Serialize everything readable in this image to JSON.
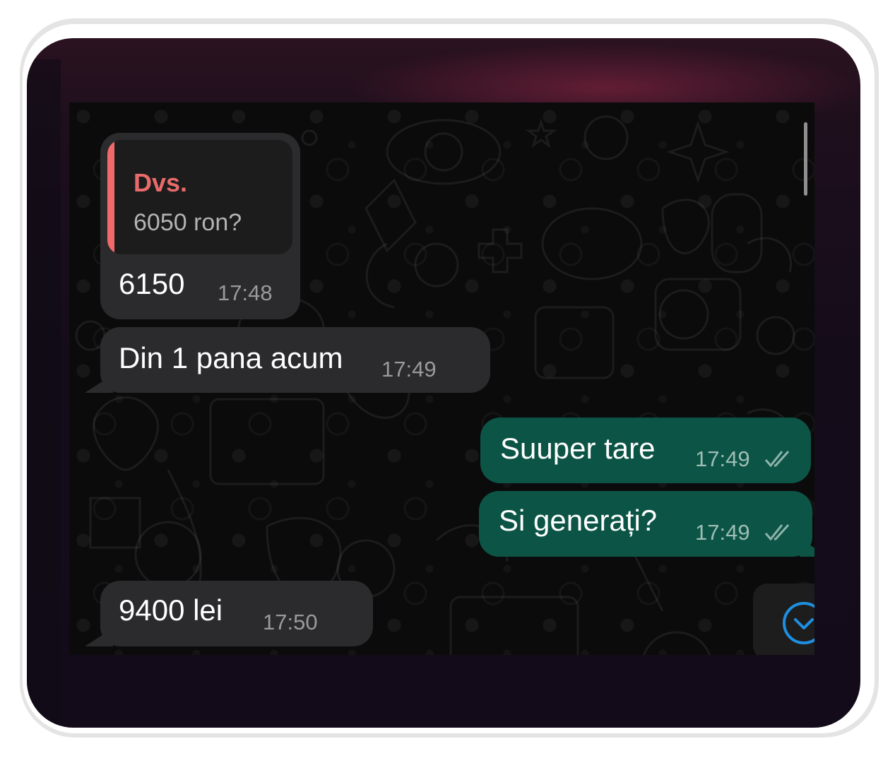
{
  "chat": {
    "messages": [
      {
        "direction": "incoming",
        "quote": {
          "author": "Dvs.",
          "text": "6050 ron?"
        },
        "text": "6150",
        "time": "17:48"
      },
      {
        "direction": "incoming",
        "text": "Din 1 pana acum",
        "time": "17:49"
      },
      {
        "direction": "outgoing",
        "text": "Suuper tare",
        "time": "17:49",
        "status_icon": "double-check-icon"
      },
      {
        "direction": "outgoing",
        "text": "Si generați?",
        "time": "17:49",
        "status_icon": "double-check-icon"
      },
      {
        "direction": "incoming",
        "text": "9400 lei",
        "time": "17:50"
      }
    ],
    "scroll_button_icon": "chevron-down-circle-icon"
  },
  "colors": {
    "incoming_bubble": "#2b2b2d",
    "outgoing_bubble": "#0c5546",
    "quote_accent": "#f06a6a",
    "scroll_button_icon": "#1e8fe0"
  }
}
